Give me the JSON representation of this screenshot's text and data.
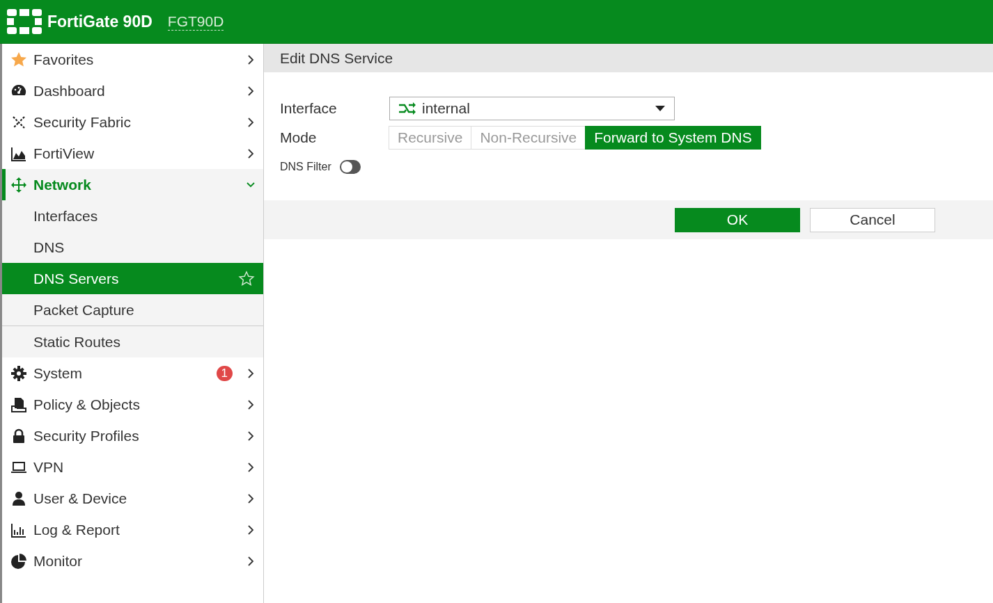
{
  "header": {
    "product": "FortiGate 90D",
    "hostname": "FGT90D"
  },
  "sidebar": {
    "items": [
      {
        "label": "Favorites",
        "expanded": false
      },
      {
        "label": "Dashboard",
        "expanded": false
      },
      {
        "label": "Security Fabric",
        "expanded": false
      },
      {
        "label": "FortiView",
        "expanded": false
      },
      {
        "label": "Network",
        "expanded": true,
        "children": [
          {
            "label": "Interfaces",
            "selected": false
          },
          {
            "label": "DNS",
            "selected": false
          },
          {
            "label": "DNS Servers",
            "selected": true
          },
          {
            "label": "Packet Capture",
            "selected": false
          },
          {
            "label": "Static Routes",
            "selected": false
          }
        ]
      },
      {
        "label": "System",
        "expanded": false,
        "badge": "1"
      },
      {
        "label": "Policy & Objects",
        "expanded": false
      },
      {
        "label": "Security Profiles",
        "expanded": false
      },
      {
        "label": "VPN",
        "expanded": false
      },
      {
        "label": "User & Device",
        "expanded": false
      },
      {
        "label": "Log & Report",
        "expanded": false
      },
      {
        "label": "Monitor",
        "expanded": false
      }
    ]
  },
  "dialog": {
    "title": "Edit DNS Service",
    "interface": {
      "label": "Interface",
      "value": "internal"
    },
    "mode": {
      "label": "Mode",
      "options": [
        {
          "label": "Recursive",
          "selected": false
        },
        {
          "label": "Non-Recursive",
          "selected": false
        },
        {
          "label": "Forward to System DNS",
          "selected": true
        }
      ]
    },
    "dns_filter": {
      "label": "DNS Filter",
      "on": false
    },
    "buttons": [
      {
        "label": "OK",
        "kind": "primary"
      },
      {
        "label": "Cancel",
        "kind": "secondary"
      }
    ]
  }
}
